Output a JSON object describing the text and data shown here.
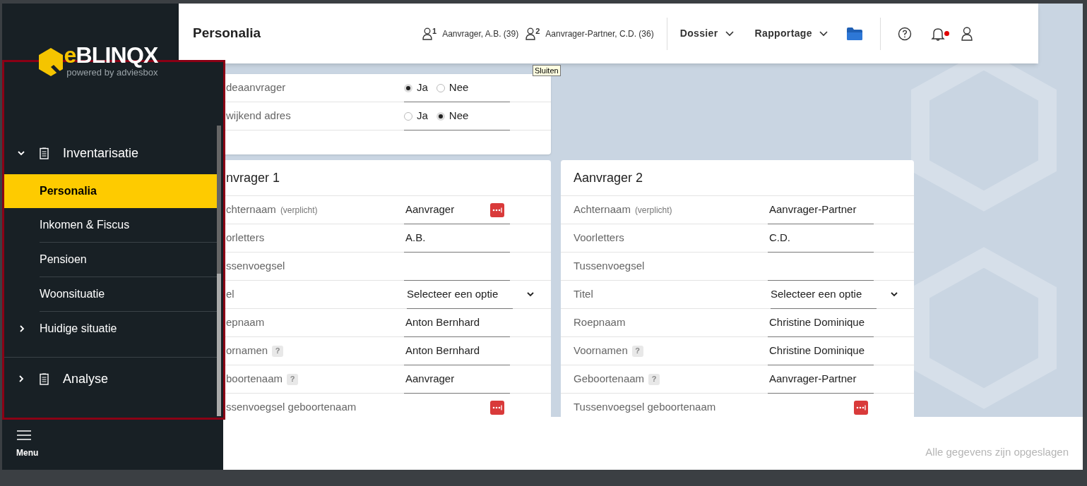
{
  "logo": {
    "mark": "e",
    "word": "BLINQX",
    "tagline": "powered by adviesbox"
  },
  "header": {
    "title": "Personalia",
    "applicants": [
      {
        "number": "1",
        "name": "Aanvrager, A.B. (39)"
      },
      {
        "number": "2",
        "name": "Aanvrager-Partner, C.D. (36)"
      }
    ],
    "menus": [
      "Dossier",
      "Rapportage"
    ],
    "notification_dot": true
  },
  "tooltip": "Sluiten",
  "navigation": [
    {
      "label": "Inventarisatie",
      "expanded": true,
      "children": [
        {
          "label": "Personalia",
          "selected": true
        },
        {
          "label": "Inkomen & Fiscus",
          "selected": false
        },
        {
          "label": "Pensioen",
          "selected": false
        },
        {
          "label": "Woonsituatie",
          "selected": false
        },
        {
          "label": "Huidige situatie",
          "selected": false,
          "expanded": false
        }
      ]
    },
    {
      "label": "Analyse",
      "expanded": false
    }
  ],
  "menu_button": "Menu",
  "cards": [
    {
      "rows": [
        {
          "kind": "radio",
          "label": "deaanvrager",
          "options": [
            {
              "label": "Ja",
              "selected": true
            },
            {
              "label": "Nee",
              "selected": false
            }
          ]
        },
        {
          "kind": "radio",
          "label": "wijkend adres",
          "options": [
            {
              "label": "Ja",
              "selected": false
            },
            {
              "label": "Nee",
              "selected": true
            }
          ]
        },
        {
          "kind": "blank"
        }
      ]
    },
    {
      "title": "nvrager 1",
      "rows": [
        {
          "kind": "text",
          "label": "chternaam",
          "hint": "(verplicht)",
          "value": "Aanvrager",
          "action": true
        },
        {
          "kind": "text",
          "label": "orletters",
          "value": "A.B."
        },
        {
          "kind": "text",
          "label": "ssenvoegsel"
        },
        {
          "kind": "select",
          "label": "el",
          "value": "Selecteer een optie"
        },
        {
          "kind": "text",
          "label": "epnaam",
          "value": "Anton Bernhard"
        },
        {
          "kind": "text",
          "label": "ornamen",
          "help": "?",
          "value": "Anton Bernhard"
        },
        {
          "kind": "text",
          "label": "boortenaam",
          "help": "?",
          "value": "Aanvrager"
        },
        {
          "kind": "text",
          "label": "ssenvoegsel geboortenaam",
          "action": true
        }
      ]
    },
    {
      "title": "Aanvrager 2",
      "rows": [
        {
          "kind": "text",
          "label": "Achternaam",
          "hint": "(verplicht)",
          "value": "Aanvrager-Partner"
        },
        {
          "kind": "text",
          "label": "Voorletters",
          "value": "C.D."
        },
        {
          "kind": "text",
          "label": "Tussenvoegsel"
        },
        {
          "kind": "select",
          "label": "Titel",
          "value": "Selecteer een optie"
        },
        {
          "kind": "text",
          "label": "Roepnaam",
          "value": "Christine Dominique"
        },
        {
          "kind": "text",
          "label": "Voornamen",
          "help": "?",
          "value": "Christine Dominique"
        },
        {
          "kind": "text",
          "label": "Geboortenaam",
          "help": "?",
          "value": "Aanvrager-Partner"
        },
        {
          "kind": "text",
          "label": "Tussenvoegsel geboortenaam",
          "action": true
        }
      ]
    }
  ],
  "status": "Alle gegevens zijn opgeslagen"
}
